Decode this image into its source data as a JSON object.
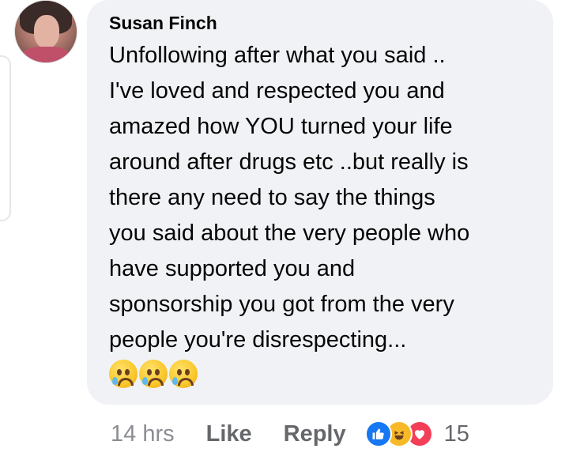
{
  "comment": {
    "author": "Susan Finch",
    "text": "Unfollowing after what you said ..\nI've loved and respected you and\namazed how YOU turned your life\naround after drugs etc ..but really is\nthere any need to say the things\nyou said about the very people who\nhave supported you and\nsponsorship you got from the very\npeople you're disrespecting...",
    "emojis": [
      "sad-relieved-face",
      "sad-relieved-face",
      "sad-relieved-face"
    ]
  },
  "actions": {
    "time": "14 hrs",
    "like_label": "Like",
    "reply_label": "Reply",
    "reaction_count": "15",
    "reaction_icons": [
      "like-icon",
      "haha-icon",
      "love-icon"
    ]
  },
  "colors": {
    "bubble": "#f0f2f5",
    "text": "#050505",
    "meta": "#65676b",
    "like_blue": "#1877f2",
    "love_red": "#f33e58",
    "haha_yellow": "#f7b928"
  }
}
